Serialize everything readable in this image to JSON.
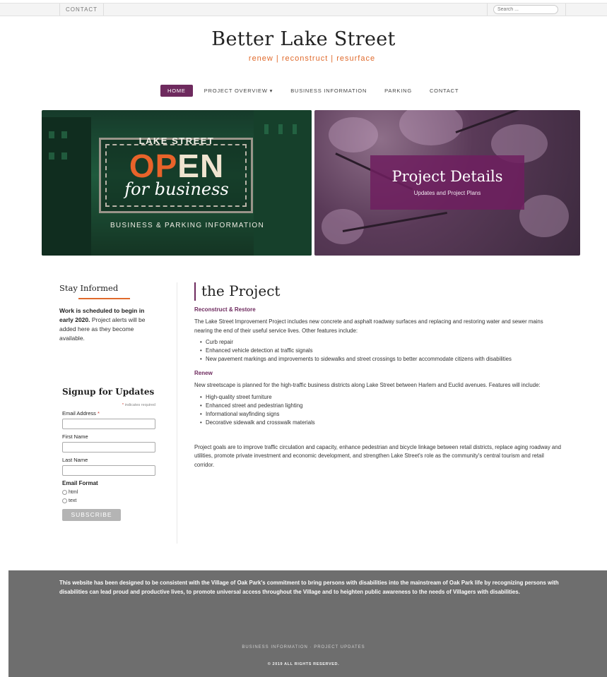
{
  "topbar": {
    "contact": "CONTACT",
    "search_placeholder": "Search ..."
  },
  "header": {
    "title": "Better Lake Street",
    "tagline": "renew | reconstruct | resurface"
  },
  "nav": {
    "home": "HOME",
    "project_overview": "PROJECT OVERVIEW ▾",
    "business_information": "BUSINESS INFORMATION",
    "parking": "PARKING",
    "contact": "CONTACT"
  },
  "hero_left": {
    "lake_street": "LAKE STREET",
    "open_o": "OP",
    "open_e": "EN",
    "for_business": "for business",
    "business_parking": "BUSINESS & PARKING INFORMATION"
  },
  "hero_right": {
    "title": "Project Details",
    "subtitle": "Updates and Project Plans"
  },
  "sidebar": {
    "stay_title": "Stay Informed",
    "stay_bold": "Work is scheduled to begin in early 2020.",
    "stay_rest": " Project alerts will be added here as they become available."
  },
  "signup": {
    "title": "Signup for Updates",
    "required_star": "*",
    "required_note": " indicates required",
    "email_label": "Email Address ",
    "first_name_label": "First Name",
    "last_name_label": "Last Name",
    "format_label": "Email Format",
    "format_html": "html",
    "format_text": "text",
    "subscribe": "SUBSCRIBE"
  },
  "main": {
    "title": "the Project",
    "section1_heading": "Reconstruct & Restore",
    "section1_text": "The Lake Street Improvement Project includes new concrete and asphalt roadway surfaces and replacing and restoring water and sewer mains nearing the end of their useful service lives. Other features include:",
    "section1_items": [
      "Curb repair",
      "Enhanced vehicle detection at traffic signals",
      "New pavement markings and improvements to sidewalks and street crossings to better accommodate citizens with disabilities"
    ],
    "section2_heading": "Renew",
    "section2_text": "New streetscape is planned for the high-traffic business districts along Lake Street between Harlem and Euclid avenues. Features will include:",
    "section2_items": [
      "High-quality street furniture",
      "Enhanced street and pedestrian lighting",
      "Informational wayfinding signs",
      "Decorative sidewalk and crosswalk materials"
    ],
    "goals_text": "Project goals are to improve traffic circulation and capacity, enhance pedestrian and bicycle linkage between retail districts, replace aging roadway and utilities, promote private investment and economic development, and strengthen Lake Street's role as the community's central tourism and retail corridor."
  },
  "footer": {
    "text": "This website has been designed to be consistent with the Village of Oak Park's commitment to bring persons with disabilities into the mainstream of Oak Park life by recognizing persons with disabilities can lead proud and productive lives, to promote universal access throughout the Village and to heighten public awareness to the needs of Villagers with disabilities.",
    "link_business": "BUSINESS INFORMATION",
    "link_separator": " · ",
    "link_updates": "PROJECT UPDATES",
    "copyright": "© 2019 ALL RIGHTS RESERVED."
  },
  "colors": {
    "accent_purple": "#6e2a5e",
    "accent_orange": "#e06a2c",
    "footer_gray": "#6e6e6e"
  }
}
